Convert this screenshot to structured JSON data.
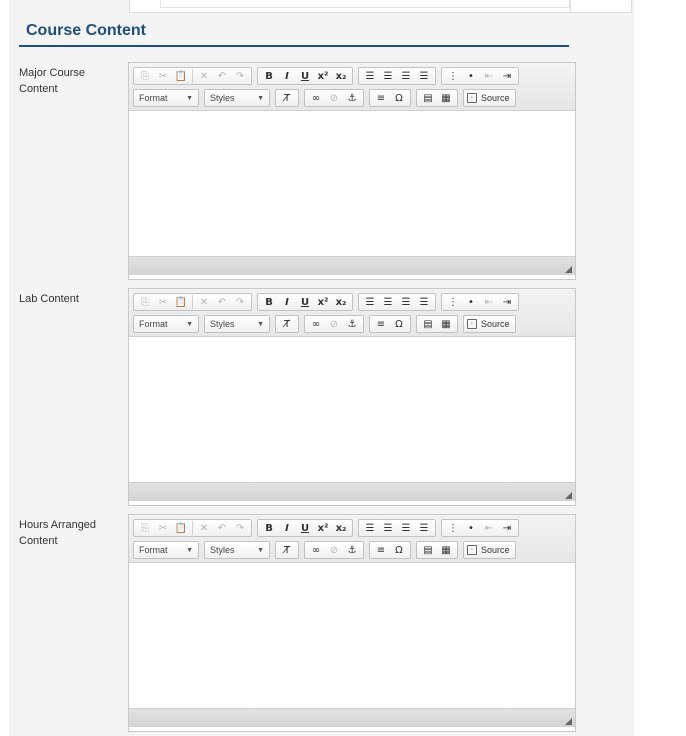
{
  "section": {
    "title": "Course Content"
  },
  "toolbar": {
    "format_label": "Format",
    "styles_label": "Styles",
    "source_label": "Source"
  },
  "fields": [
    {
      "label": "Major Course Content"
    },
    {
      "label": "Lab Content"
    },
    {
      "label": "Hours Arranged Content"
    }
  ],
  "colors": {
    "title": "#1f4e79",
    "panel_bg": "#f4f4f4"
  }
}
